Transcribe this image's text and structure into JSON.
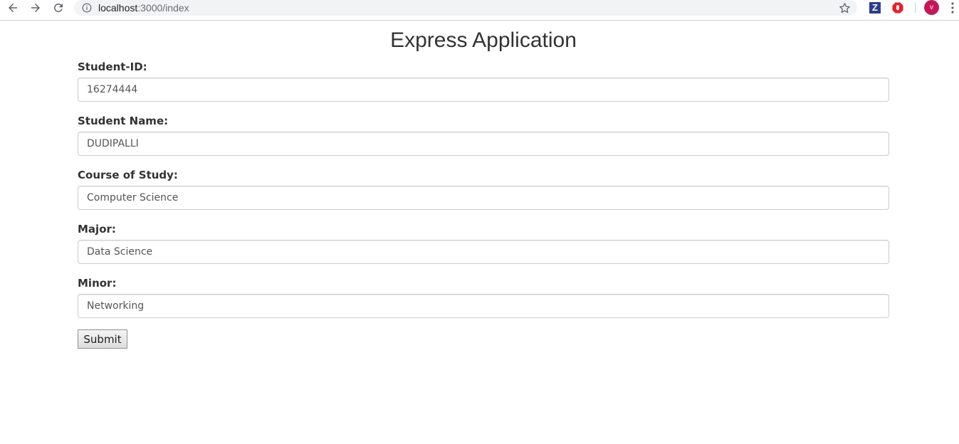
{
  "browser": {
    "url_host": "localhost",
    "url_path": ":3000/index",
    "avatar_initial": "v",
    "icons": {
      "back": "arrow-left-icon",
      "forward": "arrow-right-icon",
      "reload": "reload-icon",
      "info": "info-icon",
      "bookmark": "star-icon",
      "ext1": "zotero-extension-icon",
      "ext2": "adblock-extension-icon",
      "menu": "kebab-menu-icon"
    },
    "ext1_letter": "Z",
    "colors": {
      "avatar": "#c2185b",
      "ext1": "#2b3e8c",
      "ext2": "#e8202a"
    }
  },
  "page": {
    "title": "Express Application"
  },
  "form": {
    "fields": [
      {
        "label": "Student-ID:",
        "value": "16274444"
      },
      {
        "label": "Student Name:",
        "value": "DUDIPALLI"
      },
      {
        "label": "Course of Study:",
        "value": "Computer Science"
      },
      {
        "label": "Major:",
        "value": "Data Science"
      },
      {
        "label": "Minor:",
        "value": "Networking"
      }
    ],
    "submit_label": "Submit"
  }
}
